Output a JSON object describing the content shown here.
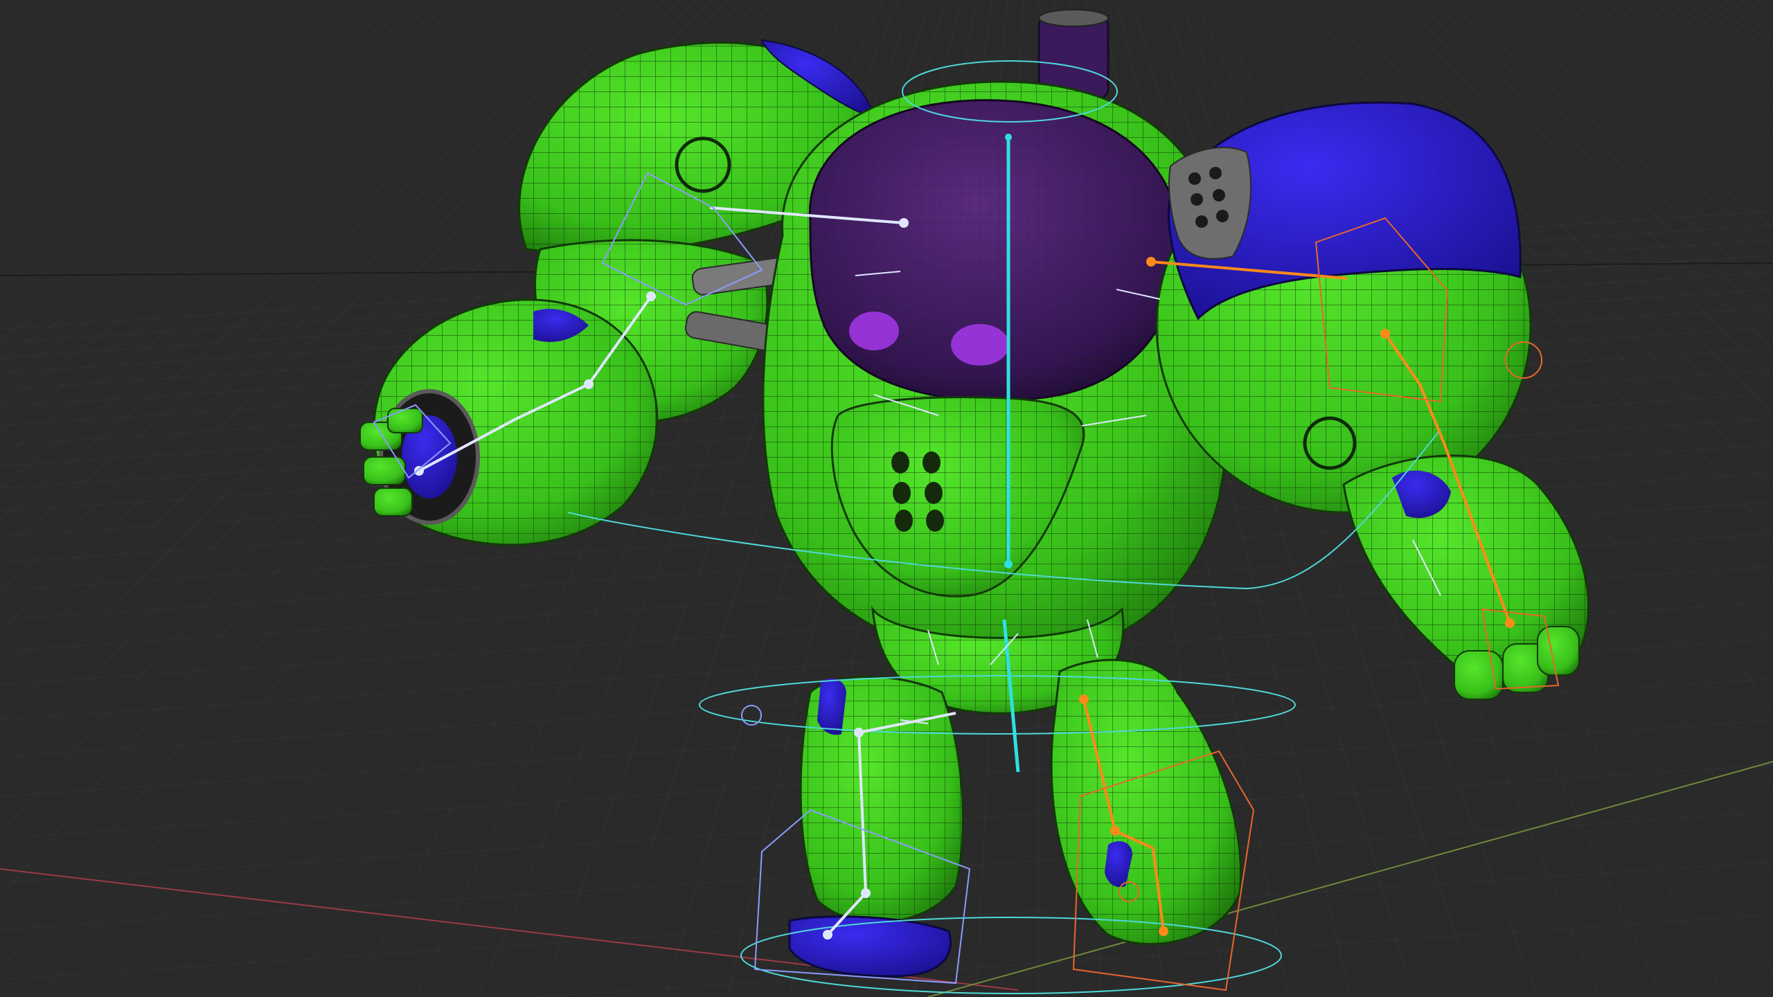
{
  "viewport": {
    "background": "#2a2a2a",
    "grid_color": "#3a3a3a",
    "grid_minor_color": "#333333",
    "x_axis_color": "#9b3a46",
    "y_axis_color": "#6e8a3a"
  },
  "model": {
    "mesh_color": "#3ed11e",
    "mesh_dark": "#2a9a14",
    "wire_color": "#0d2a08",
    "accent_color": "#2a1fd0",
    "dome_color": "#3a1a5a",
    "metal_color": "#6a6a6a"
  },
  "rig": {
    "center_bone_color": "#30e0e0",
    "left_bone_color": "#dfe7ff",
    "right_bone_color": "#ff8a1a",
    "control_color": "#4fd8d8",
    "left_box_color": "#8c9cff",
    "right_box_color": "#e8672a",
    "eye_color": "#b43cff"
  }
}
